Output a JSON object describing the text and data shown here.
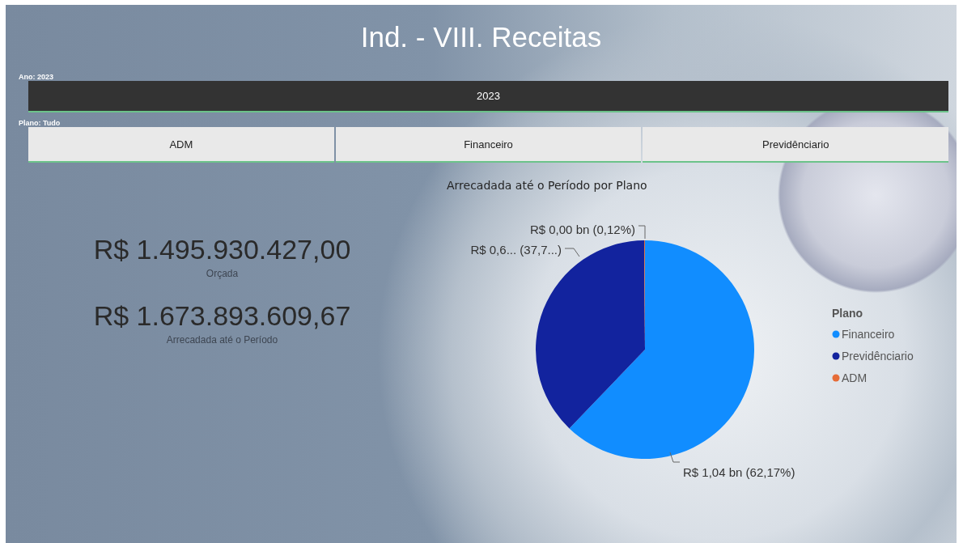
{
  "title": "Ind. - VIII. Receitas",
  "slicers": [
    {
      "header": "Ano: 2023",
      "kind": "dark",
      "options": [
        {
          "label": "2023",
          "selected": true
        }
      ]
    },
    {
      "header": "Plano: Tudo",
      "kind": "light",
      "options": [
        {
          "label": "ADM",
          "selected": false
        },
        {
          "label": "Financeiro",
          "selected": false
        },
        {
          "label": "Previdênciario",
          "selected": false
        }
      ]
    }
  ],
  "kpis": [
    {
      "value": "R$ 1.495.930.427,00",
      "label": "Orçada"
    },
    {
      "value": "R$ 1.673.893.609,67",
      "label": "Arrecadada até o Período"
    }
  ],
  "chart": {
    "chart_data": {
      "type": "pie",
      "title": "Arrecadada até o Período por Plano",
      "categories": [
        "Financeiro",
        "Previdênciario",
        "ADM"
      ],
      "series": [
        {
          "name": "Plano",
          "values": [
            62.17,
            37.71,
            0.12
          ]
        }
      ],
      "colors": [
        "#118dff",
        "#12239e",
        "#e66c37"
      ],
      "legend": "right",
      "value_labels": [
        "R$ 1,04 bn (62,17%)",
        "R$ 0,6... (37,7...)",
        "R$ 0,00 bn (0,12%)"
      ]
    }
  }
}
